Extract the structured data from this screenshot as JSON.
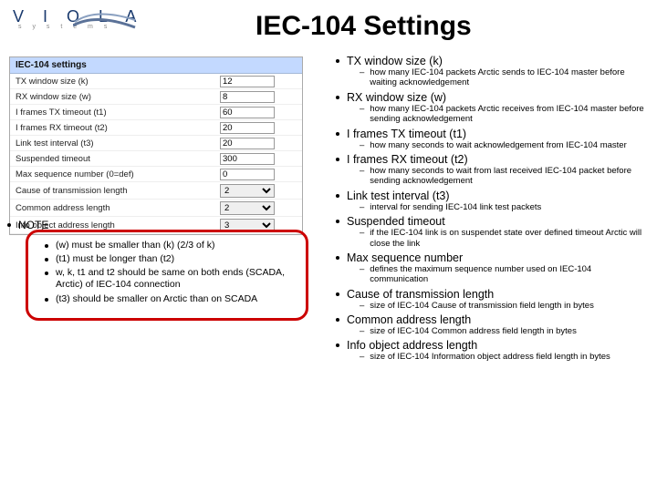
{
  "logo": {
    "brand": "V I O L A",
    "sub": "s y s t e m s"
  },
  "title": "IEC-104 Settings",
  "screenshot": {
    "heading": "IEC-104 settings",
    "rows": [
      {
        "label": "TX window size (k)",
        "value": "12",
        "type": "text"
      },
      {
        "label": "RX window size (w)",
        "value": "8",
        "type": "text"
      },
      {
        "label": "I frames TX timeout (t1)",
        "value": "60",
        "type": "text"
      },
      {
        "label": "I frames RX timeout (t2)",
        "value": "20",
        "type": "text"
      },
      {
        "label": "Link test interval (t3)",
        "value": "20",
        "type": "text"
      },
      {
        "label": "Suspended timeout",
        "value": "300",
        "type": "text"
      },
      {
        "label": "Max sequence number (0=def)",
        "value": "0",
        "type": "text"
      },
      {
        "label": "Cause of transmission length",
        "value": "2",
        "type": "select"
      },
      {
        "label": "Common address length",
        "value": "2",
        "type": "select"
      },
      {
        "label": "Info object address length",
        "value": "3",
        "type": "select"
      }
    ]
  },
  "note": {
    "heading": "NOTE",
    "items": [
      "(w) must be smaller than (k) (2/3 of k)",
      "(t1) must be longer than (t2)",
      "w, k, t1 and t2 should be same on both ends (SCADA, Arctic) of IEC-104 connection",
      "(t3) should be smaller on Arctic than on SCADA"
    ]
  },
  "defs": [
    {
      "title": "TX window size (k)",
      "desc": "how many IEC-104 packets Arctic sends to IEC-104 master before waiting acknowledgement"
    },
    {
      "title": "RX window size (w)",
      "desc": "how many IEC-104 packets Arctic receives from IEC-104 master before sending acknowledgement"
    },
    {
      "title": "I frames TX timeout (t1)",
      "desc": "how many seconds to wait acknowledgement from IEC-104 master"
    },
    {
      "title": "I frames RX timeout (t2)",
      "desc": "how many seconds to wait from last received IEC-104 packet before sending acknowledgement"
    },
    {
      "title": "Link test interval (t3)",
      "desc": "interval for sending IEC-104 link test packets"
    },
    {
      "title": "Suspended timeout",
      "desc": "if the IEC-104 link is on suspendet state over defined timeout Arctic will close the link"
    },
    {
      "title": "Max sequence number",
      "desc": "defines the maximum sequence number used on IEC-104 communication"
    },
    {
      "title": "Cause of transmission length",
      "desc": "size of IEC-104 Cause of transmission field length in bytes"
    },
    {
      "title": "Common address length",
      "desc": "size of IEC-104 Common address field length in bytes"
    },
    {
      "title": "Info object address length",
      "desc": "size of IEC-104 Information object address field length in bytes"
    }
  ]
}
